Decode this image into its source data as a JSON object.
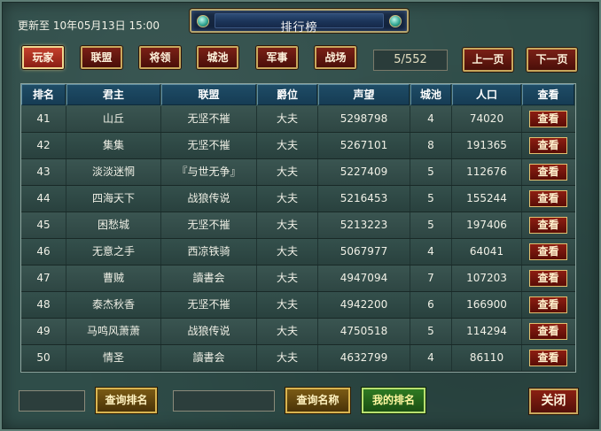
{
  "header": {
    "update_label": "更新至 10年05月13日 15:00",
    "title": "排行榜"
  },
  "tabs": [
    {
      "label": "玩家",
      "active": true
    },
    {
      "label": "联盟",
      "active": false
    },
    {
      "label": "将领",
      "active": false
    },
    {
      "label": "城池",
      "active": false
    },
    {
      "label": "军事",
      "active": false
    },
    {
      "label": "战场",
      "active": false
    }
  ],
  "pagination": {
    "indicator": "5/552",
    "prev_label": "上一页",
    "next_label": "下一页"
  },
  "table": {
    "columns": [
      "排名",
      "君主",
      "联盟",
      "爵位",
      "声望",
      "城池",
      "人口",
      "查看"
    ],
    "view_label": "查看",
    "rows": [
      [
        "41",
        "山丘",
        "无坚不摧",
        "大夫",
        "5298798",
        "4",
        "74020"
      ],
      [
        "42",
        "集集",
        "无坚不摧",
        "大夫",
        "5267101",
        "8",
        "191365"
      ],
      [
        "43",
        "淡淡迷惘",
        "『与世无争』",
        "大夫",
        "5227409",
        "5",
        "112676"
      ],
      [
        "44",
        "四海天下",
        "战狼传说",
        "大夫",
        "5216453",
        "5",
        "155244"
      ],
      [
        "45",
        "困愁城",
        "无坚不摧",
        "大夫",
        "5213223",
        "5",
        "197406"
      ],
      [
        "46",
        "无意之手",
        "西凉铁骑",
        "大夫",
        "5067977",
        "4",
        "64041"
      ],
      [
        "47",
        "曹贼",
        "讀書会",
        "大夫",
        "4947094",
        "7",
        "107203"
      ],
      [
        "48",
        "泰杰秋香",
        "无坚不摧",
        "大夫",
        "4942200",
        "6",
        "166900"
      ],
      [
        "49",
        "马鸣风萧萧",
        "战狼传说",
        "大夫",
        "4750518",
        "5",
        "114294"
      ],
      [
        "50",
        "情圣",
        "讀書会",
        "大夫",
        "4632799",
        "4",
        "86110"
      ]
    ]
  },
  "footer": {
    "rank_query_label": "查询排名",
    "name_query_label": "查询名称",
    "my_rank_label": "我的排名",
    "close_label": "关闭"
  }
}
